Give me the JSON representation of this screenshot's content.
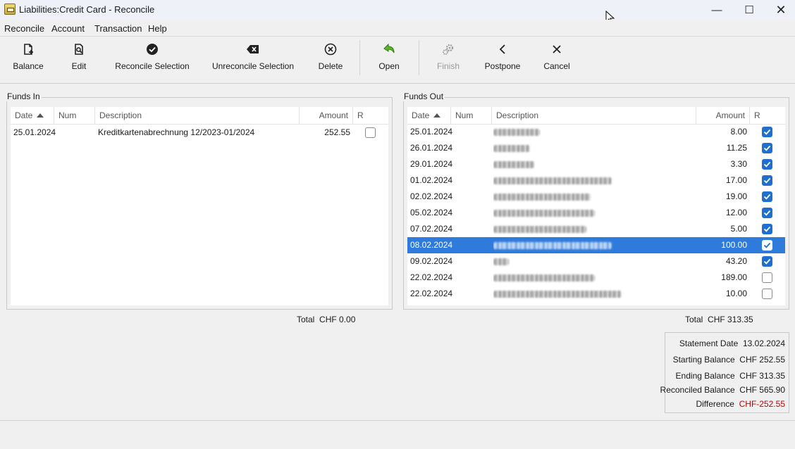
{
  "window": {
    "title": "Liabilities:Credit Card - Reconcile",
    "minimize_glyph": "—",
    "maximize_glyph": "☐",
    "close_glyph": "✕"
  },
  "menu": [
    "Reconcile",
    "Account",
    "Transaction",
    "Help"
  ],
  "toolbar": [
    {
      "label": "Balance",
      "icon": "new-balance-icon",
      "enabled": true
    },
    {
      "label": "Edit",
      "icon": "edit-icon",
      "enabled": true
    },
    {
      "label": "Reconcile Selection",
      "icon": "check-circle-icon",
      "enabled": true
    },
    {
      "label": "Unreconcile Selection",
      "icon": "backspace-icon",
      "enabled": true
    },
    {
      "label": "Delete",
      "icon": "delete-circle-icon",
      "enabled": true
    },
    {
      "label": "Open",
      "icon": "open-arrow-icon",
      "enabled": true
    },
    {
      "label": "Finish",
      "icon": "gears-icon",
      "enabled": false
    },
    {
      "label": "Postpone",
      "icon": "chevron-left-icon",
      "enabled": true
    },
    {
      "label": "Cancel",
      "icon": "cancel-x-icon",
      "enabled": true
    }
  ],
  "funds_in": {
    "title": "Funds In",
    "columns": [
      "Date",
      "Num",
      "Description",
      "Amount",
      "R"
    ],
    "rows": [
      {
        "date": "25.01.2024",
        "num": "",
        "description": "Kreditkartenabrechnung 12/2023-01/2024",
        "amount": "252.55",
        "reconciled": false
      }
    ],
    "total_label": "Total",
    "total_value": "CHF 0.00"
  },
  "funds_out": {
    "title": "Funds Out",
    "columns": [
      "Date",
      "Num",
      "Description",
      "Amount",
      "R"
    ],
    "rows": [
      {
        "date": "25.01.2024",
        "amount": "8.00",
        "reconciled": true,
        "selected": false
      },
      {
        "date": "26.01.2024",
        "amount": "11.25",
        "reconciled": true,
        "selected": false
      },
      {
        "date": "29.01.2024",
        "amount": "3.30",
        "reconciled": true,
        "selected": false
      },
      {
        "date": "01.02.2024",
        "amount": "17.00",
        "reconciled": true,
        "selected": false
      },
      {
        "date": "02.02.2024",
        "amount": "19.00",
        "reconciled": true,
        "selected": false
      },
      {
        "date": "05.02.2024",
        "amount": "12.00",
        "reconciled": true,
        "selected": false
      },
      {
        "date": "07.02.2024",
        "amount": "5.00",
        "reconciled": true,
        "selected": false
      },
      {
        "date": "08.02.2024",
        "amount": "100.00",
        "reconciled": true,
        "selected": true
      },
      {
        "date": "09.02.2024",
        "amount": "43.20",
        "reconciled": true,
        "selected": false
      },
      {
        "date": "22.02.2024",
        "amount": "189.00",
        "reconciled": false,
        "selected": false
      },
      {
        "date": "22.02.2024",
        "amount": "10.00",
        "reconciled": false,
        "selected": false
      }
    ],
    "total_label": "Total",
    "total_value": "CHF 313.35"
  },
  "summary": {
    "statement_date_label": "Statement Date",
    "statement_date": "13.02.2024",
    "starting_balance_label": "Starting Balance",
    "starting_balance": "CHF 252.55",
    "ending_balance_label": "Ending Balance",
    "ending_balance": "CHF 313.35",
    "reconciled_balance_label": "Reconciled Balance",
    "reconciled_balance": "CHF 565.90",
    "difference_label": "Difference",
    "difference": "CHF-252.55",
    "difference_color": "#c00000"
  },
  "colors": {
    "selection": "#2f7bdb",
    "checkbox": "#1f6fd1"
  }
}
